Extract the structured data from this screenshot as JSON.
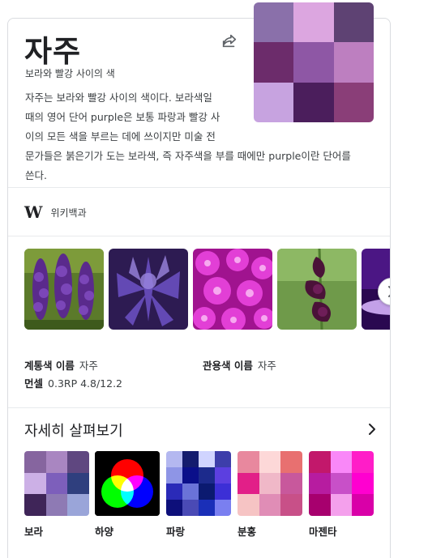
{
  "knowledge_panel": {
    "title": "자주",
    "subtitle": "보라와 빨강 사이의 색",
    "share_icon": "share-icon",
    "swatches": [
      "#8a70aa",
      "#dca6e0",
      "#5e4273",
      "#6c2c6b",
      "#8e57a5",
      "#bd7fc0",
      "#c7a3e0",
      "#4b1e5c",
      "#8a3e78"
    ],
    "description_lines": [
      "자주는 보라와 빨강 사이의 색이다. 보라색일",
      "때의 영어 단어 purple은 보통 파랑과 빨강 사",
      "이의 모든 색을 부르는 데에 쓰이지만 미술 전",
      "문가들은 붉은기가 도는 보라색, 즉 자주색을 부를 때에만 purple이란 단어를",
      "쓴다."
    ],
    "source": {
      "icon": "wikipedia-icon",
      "logo_text": "W",
      "label": "위키백과"
    },
    "gallery": [
      {
        "name": "purple-gladiolus-field"
      },
      {
        "name": "purple-cannabis-plant"
      },
      {
        "name": "magenta-ice-plant-flowers"
      },
      {
        "name": "purple-gladiolus-closeup"
      },
      {
        "name": "purple-sky-clouds"
      }
    ],
    "gallery_next_icon": "chevron-right-icon",
    "facts": [
      {
        "key": "계통색 이름",
        "value": "자주"
      },
      {
        "key": "관용색 이름",
        "value": "자주"
      },
      {
        "key": "먼셀",
        "value": "0.3RP 4.8/12.2"
      }
    ],
    "explore": {
      "title": "자세히 살펴보기",
      "chevron_icon": "chevron-right-icon",
      "items": [
        {
          "label": "보라",
          "colors": [
            "#86659f",
            "#a986c1",
            "#5f4780",
            "#ccb0e6",
            "#7d5fbb",
            "#2f3f7e",
            "#3f2558",
            "#8e7ab4",
            "#9aa5d9"
          ]
        },
        {
          "label": "하양"
        },
        {
          "label": "파랑",
          "colors": [
            "#b4b8f0",
            "#141c6e",
            "#d0d4ff",
            "#3d3eaa",
            "#8e95e6",
            "#0a0f8a",
            "#1c2a8c",
            "#5c3fe0",
            "#2a2ab8",
            "#6a73d8",
            "#0b1a70",
            "#3c2fd6",
            "#0d0f7a",
            "#4a4ab5",
            "#1a2fb8",
            "#7a7ff0"
          ]
        },
        {
          "label": "분홍",
          "colors": [
            "#e8889e",
            "#fdd8d8",
            "#e87070",
            "#e21f88",
            "#f0b8c8",
            "#c8589c",
            "#f6c4c4",
            "#e08db6",
            "#c85088"
          ]
        },
        {
          "label": "마젠타",
          "colors": [
            "#c2186b",
            "#f988f8",
            "#ff1dc8",
            "#b71ca0",
            "#c850c8",
            "#ff00d0",
            "#a7006e",
            "#f4a0ec",
            "#d900a8"
          ]
        }
      ]
    }
  }
}
